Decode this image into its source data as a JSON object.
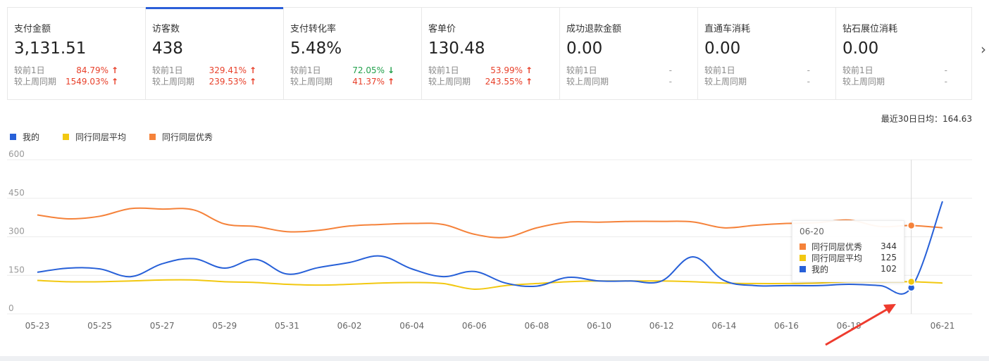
{
  "metrics": [
    {
      "label": "支付金额",
      "value": "3,131.51",
      "day_label": "较前1日",
      "day_value": "84.79%",
      "day_trend": "up",
      "week_label": "较上周同期",
      "week_value": "1549.03%",
      "week_trend": "up",
      "active": false
    },
    {
      "label": "访客数",
      "value": "438",
      "day_label": "较前1日",
      "day_value": "329.41%",
      "day_trend": "up",
      "week_label": "较上周同期",
      "week_value": "239.53%",
      "week_trend": "up",
      "active": true
    },
    {
      "label": "支付转化率",
      "value": "5.48%",
      "day_label": "较前1日",
      "day_value": "72.05%",
      "day_trend": "down",
      "week_label": "较上周同期",
      "week_value": "41.37%",
      "week_trend": "up",
      "active": false
    },
    {
      "label": "客单价",
      "value": "130.48",
      "day_label": "较前1日",
      "day_value": "53.99%",
      "day_trend": "up",
      "week_label": "较上周同期",
      "week_value": "243.55%",
      "week_trend": "up",
      "active": false
    },
    {
      "label": "成功退款金额",
      "value": "0.00",
      "day_label": "较前1日",
      "day_value": "-",
      "day_trend": "none",
      "week_label": "较上周同期",
      "week_value": "-",
      "week_trend": "none",
      "active": false
    },
    {
      "label": "直通车消耗",
      "value": "0.00",
      "day_label": "较前1日",
      "day_value": "-",
      "day_trend": "none",
      "week_label": "较上周同期",
      "week_value": "-",
      "week_trend": "none",
      "active": false
    },
    {
      "label": "钻石展位消耗",
      "value": "0.00",
      "day_label": "较前1日",
      "day_value": "-",
      "day_trend": "none",
      "week_label": "较上周同期",
      "week_value": "-",
      "week_trend": "none",
      "active": false
    }
  ],
  "next_icon": "chevron-right-icon",
  "avg_30_days": "最近30日日均：164.63",
  "colors": {
    "mine": "#2760d8",
    "avg": "#f2c811",
    "top": "#f5823a",
    "up": "#e8412b",
    "down": "#22a04c"
  },
  "chart_data": {
    "type": "line",
    "categories": [
      "05-23",
      "05-24",
      "05-25",
      "05-26",
      "05-27",
      "05-28",
      "05-29",
      "05-30",
      "05-31",
      "06-01",
      "06-02",
      "06-03",
      "06-04",
      "06-05",
      "06-06",
      "06-07",
      "06-08",
      "06-09",
      "06-10",
      "06-11",
      "06-12",
      "06-13",
      "06-14",
      "06-15",
      "06-16",
      "06-17",
      "06-18",
      "06-19",
      "06-20",
      "06-21"
    ],
    "x_tick_labels": [
      "05-23",
      "05-25",
      "05-27",
      "05-29",
      "05-31",
      "06-02",
      "06-04",
      "06-06",
      "06-08",
      "06-10",
      "06-12",
      "06-14",
      "06-16",
      "06-18",
      "06-21"
    ],
    "ylim": [
      0,
      600
    ],
    "y_ticks": [
      0,
      150,
      300,
      450,
      600
    ],
    "legend_position": "top-left",
    "grid": true,
    "series": [
      {
        "name": "我的",
        "color": "#2760d8",
        "values": [
          162,
          178,
          175,
          145,
          195,
          215,
          178,
          212,
          155,
          180,
          200,
          225,
          175,
          145,
          165,
          120,
          108,
          142,
          128,
          128,
          128,
          222,
          130,
          110,
          110,
          110,
          115,
          110,
          102,
          438
        ]
      },
      {
        "name": "同行同层平均",
        "color": "#f2c811",
        "values": [
          130,
          125,
          125,
          128,
          132,
          132,
          125,
          122,
          115,
          112,
          115,
          120,
          122,
          118,
          96,
          110,
          118,
          125,
          128,
          128,
          128,
          125,
          120,
          118,
          118,
          120,
          125,
          125,
          125,
          120
        ]
      },
      {
        "name": "同行同层优秀",
        "color": "#f5823a",
        "values": [
          385,
          370,
          380,
          410,
          408,
          405,
          350,
          340,
          320,
          325,
          342,
          348,
          352,
          348,
          310,
          298,
          335,
          357,
          357,
          360,
          360,
          358,
          335,
          345,
          352,
          355,
          365,
          340,
          344,
          335
        ]
      }
    ],
    "tooltip": {
      "date": "06-20",
      "rows": [
        {
          "name": "同行同层优秀",
          "value": "344",
          "color": "#f5823a"
        },
        {
          "name": "同行同层平均",
          "value": "125",
          "color": "#f2c811"
        },
        {
          "name": "我的",
          "value": "102",
          "color": "#2760d8"
        }
      ]
    }
  }
}
